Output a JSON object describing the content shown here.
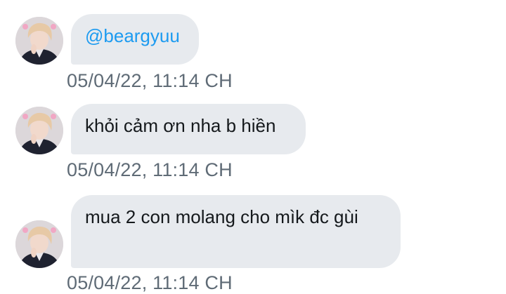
{
  "colors": {
    "bubble_bg": "#e7eaee",
    "mention": "#1d9bf0",
    "timestamp": "#5f6b76",
    "text": "#15191c"
  },
  "messages": [
    {
      "text": "@beargyuu",
      "is_mention": true,
      "timestamp": "05/04/22, 11:14 CH",
      "avatar_icon": "user-avatar"
    },
    {
      "text": "khỏi cảm ơn nha b hiền",
      "is_mention": false,
      "timestamp": "05/04/22, 11:14 CH",
      "avatar_icon": "user-avatar"
    },
    {
      "text": "mua 2 con molang cho mìk đc gùi",
      "is_mention": false,
      "timestamp": "05/04/22, 11:14 CH",
      "avatar_icon": "user-avatar"
    }
  ]
}
